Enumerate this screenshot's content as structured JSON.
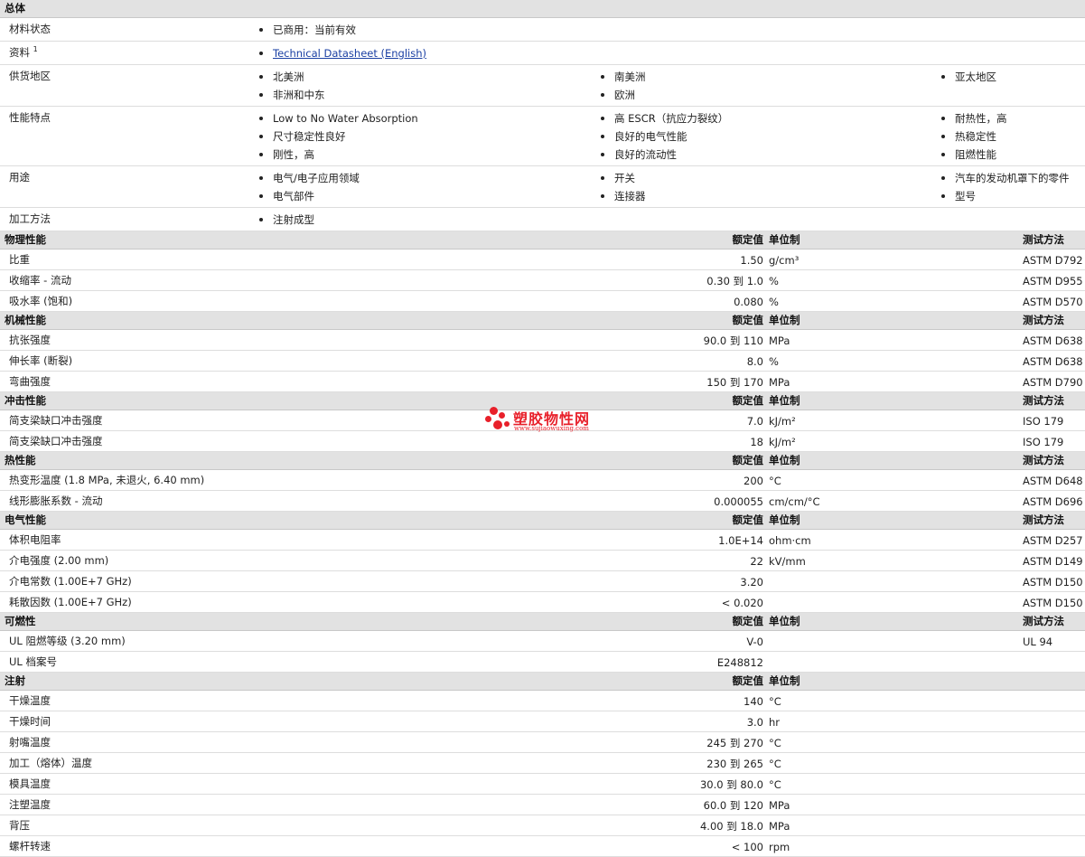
{
  "overview": {
    "title": "总体",
    "rows": [
      {
        "label": "材料状态",
        "sup": "",
        "items": [
          [
            "已商用：当前有效"
          ],
          [],
          []
        ]
      },
      {
        "label": "资料",
        "sup": "1",
        "link": "Technical Datasheet (English)"
      },
      {
        "label": "供货地区",
        "sup": "",
        "items": [
          [
            "北美洲",
            "非洲和中东"
          ],
          [
            "南美洲",
            "欧洲"
          ],
          [
            "亚太地区"
          ]
        ]
      },
      {
        "label": "性能特点",
        "sup": "",
        "items": [
          [
            "Low to No Water Absorption",
            "尺寸稳定性良好",
            "刚性，高"
          ],
          [
            "高 ESCR（抗应力裂纹）",
            "良好的电气性能",
            "良好的流动性"
          ],
          [
            "耐热性，高",
            "热稳定性",
            "阻燃性能"
          ]
        ]
      },
      {
        "label": "用途",
        "sup": "",
        "items": [
          [
            "电气/电子应用领域",
            "电气部件"
          ],
          [
            "开关",
            "连接器"
          ],
          [
            "汽车的发动机罩下的零件",
            "型号"
          ]
        ]
      },
      {
        "label": "加工方法",
        "sup": "",
        "items": [
          [
            "注射成型"
          ],
          [],
          []
        ]
      }
    ]
  },
  "column_headers": {
    "value": "额定值",
    "unit": "单位制",
    "method": "测试方法"
  },
  "sections": [
    {
      "title": "物理性能",
      "show_method": true,
      "rows": [
        {
          "label": "比重",
          "value": "1.50",
          "unit": "g/cm³",
          "method": "ASTM D792"
        },
        {
          "label": "收缩率 - 流动",
          "value": "0.30 到 1.0",
          "unit": "%",
          "method": "ASTM D955"
        },
        {
          "label": "吸水率 (饱和)",
          "value": "0.080",
          "unit": "%",
          "method": "ASTM D570"
        }
      ]
    },
    {
      "title": "机械性能",
      "show_method": true,
      "rows": [
        {
          "label": "抗张强度",
          "value": "90.0 到 110",
          "unit": "MPa",
          "method": "ASTM D638"
        },
        {
          "label": "伸长率 (断裂)",
          "value": "8.0",
          "unit": "%",
          "method": "ASTM D638"
        },
        {
          "label": "弯曲强度",
          "value": "150 到 170",
          "unit": "MPa",
          "method": "ASTM D790"
        }
      ]
    },
    {
      "title": "冲击性能",
      "show_method": true,
      "rows": [
        {
          "label": "简支梁缺口冲击强度",
          "value": "7.0",
          "unit": "kJ/m²",
          "method": "ISO 179"
        },
        {
          "label": "简支梁缺口冲击强度",
          "value": "18",
          "unit": "kJ/m²",
          "method": "ISO 179"
        }
      ]
    },
    {
      "title": "热性能",
      "show_method": true,
      "rows": [
        {
          "label": "热变形温度 (1.8 MPa, 未退火, 6.40 mm)",
          "value": "200",
          "unit": "°C",
          "method": "ASTM D648"
        },
        {
          "label": "线形膨胀系数 - 流动",
          "value": "0.000055",
          "unit": "cm/cm/°C",
          "method": "ASTM D696"
        }
      ]
    },
    {
      "title": "电气性能",
      "show_method": true,
      "rows": [
        {
          "label": "体积电阻率",
          "value": "1.0E+14",
          "unit": "ohm·cm",
          "method": "ASTM D257"
        },
        {
          "label": "介电强度 (2.00 mm)",
          "value": "22",
          "unit": "kV/mm",
          "method": "ASTM D149"
        },
        {
          "label": "介电常数 (1.00E+7 GHz)",
          "value": "3.20",
          "unit": "",
          "method": "ASTM D150"
        },
        {
          "label": "耗散因数 (1.00E+7 GHz)",
          "value": "< 0.020",
          "unit": "",
          "method": "ASTM D150"
        }
      ]
    },
    {
      "title": "可燃性",
      "show_method": true,
      "rows": [
        {
          "label": "UL 阻燃等级 (3.20 mm)",
          "value": "V-0",
          "unit": "",
          "method": "UL 94"
        },
        {
          "label": "UL 档案号",
          "value": "E248812",
          "unit": "",
          "method": ""
        }
      ]
    },
    {
      "title": "注射",
      "show_method": false,
      "rows": [
        {
          "label": "干燥温度",
          "value": "140",
          "unit": "°C",
          "method": ""
        },
        {
          "label": "干燥时间",
          "value": "3.0",
          "unit": "hr",
          "method": ""
        },
        {
          "label": "射嘴温度",
          "value": "245 到 270",
          "unit": "°C",
          "method": ""
        },
        {
          "label": "加工（熔体）温度",
          "value": "230 到 265",
          "unit": "°C",
          "method": ""
        },
        {
          "label": "模具温度",
          "value": "30.0 到 80.0",
          "unit": "°C",
          "method": ""
        },
        {
          "label": "注塑温度",
          "value": "60.0 到 120",
          "unit": "MPa",
          "method": ""
        },
        {
          "label": "背压",
          "value": "4.00 到 18.0",
          "unit": "MPa",
          "method": ""
        },
        {
          "label": "螺杆转速",
          "value": "< 100",
          "unit": "rpm",
          "method": ""
        }
      ]
    }
  ],
  "watermark": {
    "name": "塑胶物性网",
    "url": "www.sujiaowuxing.com",
    "color": "#e8202a"
  }
}
